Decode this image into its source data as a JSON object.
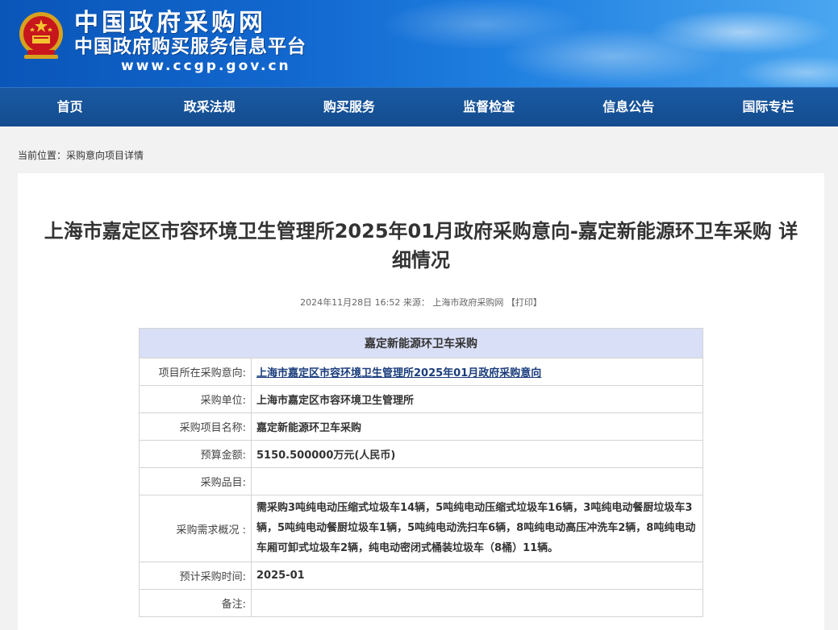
{
  "header": {
    "site_title": "中国政府采购网",
    "site_subtitle": "中国政府购买服务信息平台",
    "site_url": "www.ccgp.gov.cn",
    "brand_color": "#0a55b8"
  },
  "nav": {
    "items": [
      "首页",
      "政采法规",
      "购买服务",
      "监督检查",
      "信息公告",
      "国际专栏"
    ]
  },
  "breadcrumb": {
    "label": "当前位置：",
    "current": "采购意向项目详情"
  },
  "article": {
    "title": "上海市嘉定区市容环境卫生管理所2025年01月政府采购意向-嘉定新能源环卫车采购 详细情况",
    "date": "2024年11月28日 16:52",
    "source_label": "来源：",
    "source": "上海市政府采购网",
    "print_link": "【打印】"
  },
  "detail_table": {
    "heading": "嘉定新能源环卫车采购",
    "rows": [
      {
        "label": "项目所在采购意向:",
        "value": "上海市嘉定区市容环境卫生管理所2025年01月政府采购意向",
        "link": true
      },
      {
        "label": "采购单位:",
        "value": "上海市嘉定区市容环境卫生管理所"
      },
      {
        "label": "采购项目名称:",
        "value": "嘉定新能源环卫车采购"
      },
      {
        "label": "预算金额:",
        "value": "5150.500000万元(人民币)"
      },
      {
        "label": "采购品目:",
        "value": ""
      },
      {
        "label": "采购需求概况 :",
        "value": "需采购3吨纯电动压缩式垃圾车14辆，5吨纯电动压缩式垃圾车16辆，3吨纯电动餐厨垃圾车3辆，5吨纯电动餐厨垃圾车1辆，5吨纯电动洗扫车6辆，8吨纯电动高压冲洗车2辆，8吨纯电动车厢可卸式垃圾车2辆，纯电动密闭式桶装垃圾车（8桶）11辆。"
      },
      {
        "label": "预计采购时间:",
        "value": "2025-01"
      },
      {
        "label": "备注:",
        "value": ""
      }
    ]
  }
}
